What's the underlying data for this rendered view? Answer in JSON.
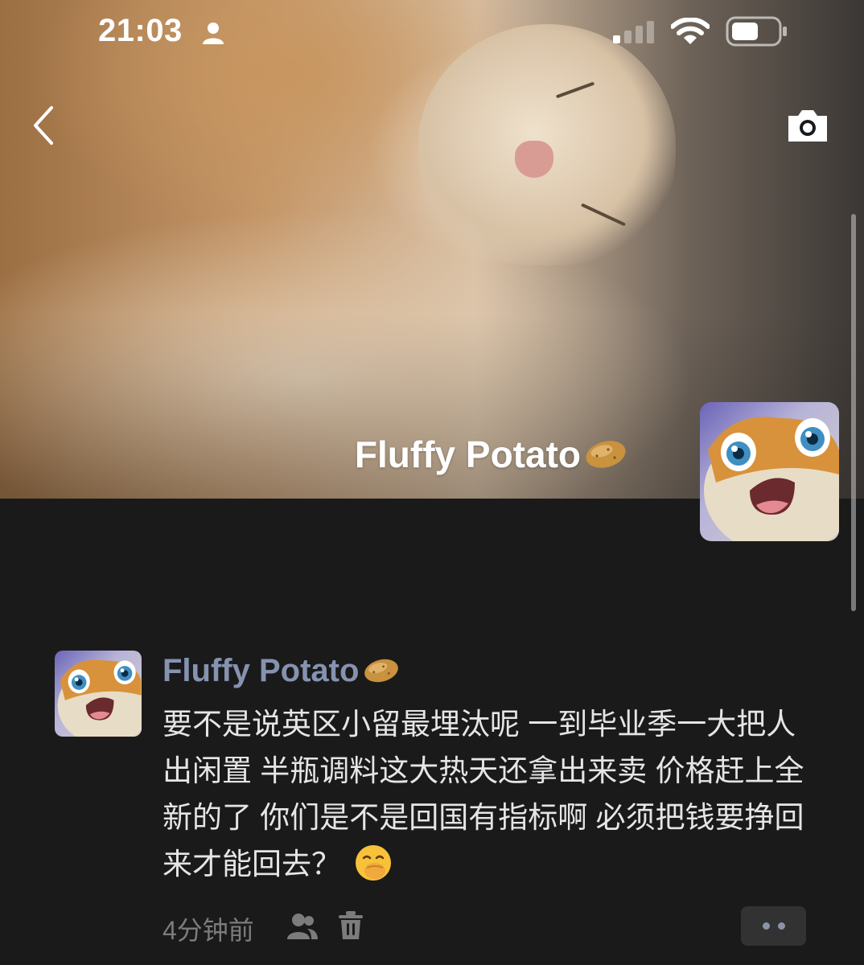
{
  "status_bar": {
    "time": "21:03",
    "person_icon": "person-icon",
    "signal_icon": "cellular-signal-icon",
    "wifi_icon": "wifi-icon",
    "battery_icon": "battery-icon"
  },
  "navigation": {
    "back_icon": "chevron-left-icon",
    "camera_icon": "camera-icon"
  },
  "profile": {
    "name": "Fluffy Potato",
    "name_emoji": "potato-emoji",
    "cover_image": "sleeping-cat-photo",
    "avatar": "crying-cartoon-avatar"
  },
  "post": {
    "author": "Fluffy Potato",
    "author_emoji": "potato-emoji",
    "text": "要不是说英区小留最埋汰呢 一到毕业季一大把人出闲置 半瓶调料这大热天还拿出来卖 价格赶上全新的了 你们是不是回国有指标啊 必须把钱要挣回来才能回去？",
    "trailing_emoji": "hand-over-mouth-emoji",
    "time_ago": "4分钟前",
    "visibility_icon": "people-icon",
    "delete_icon": "trash-icon",
    "more_icon": "more-dots-icon"
  },
  "colors": {
    "background": "#1a1a1a",
    "author_name": "#8593b0",
    "post_text": "#e5e5e5",
    "meta_text": "#7c7c7c",
    "more_button_bg": "#323232"
  }
}
